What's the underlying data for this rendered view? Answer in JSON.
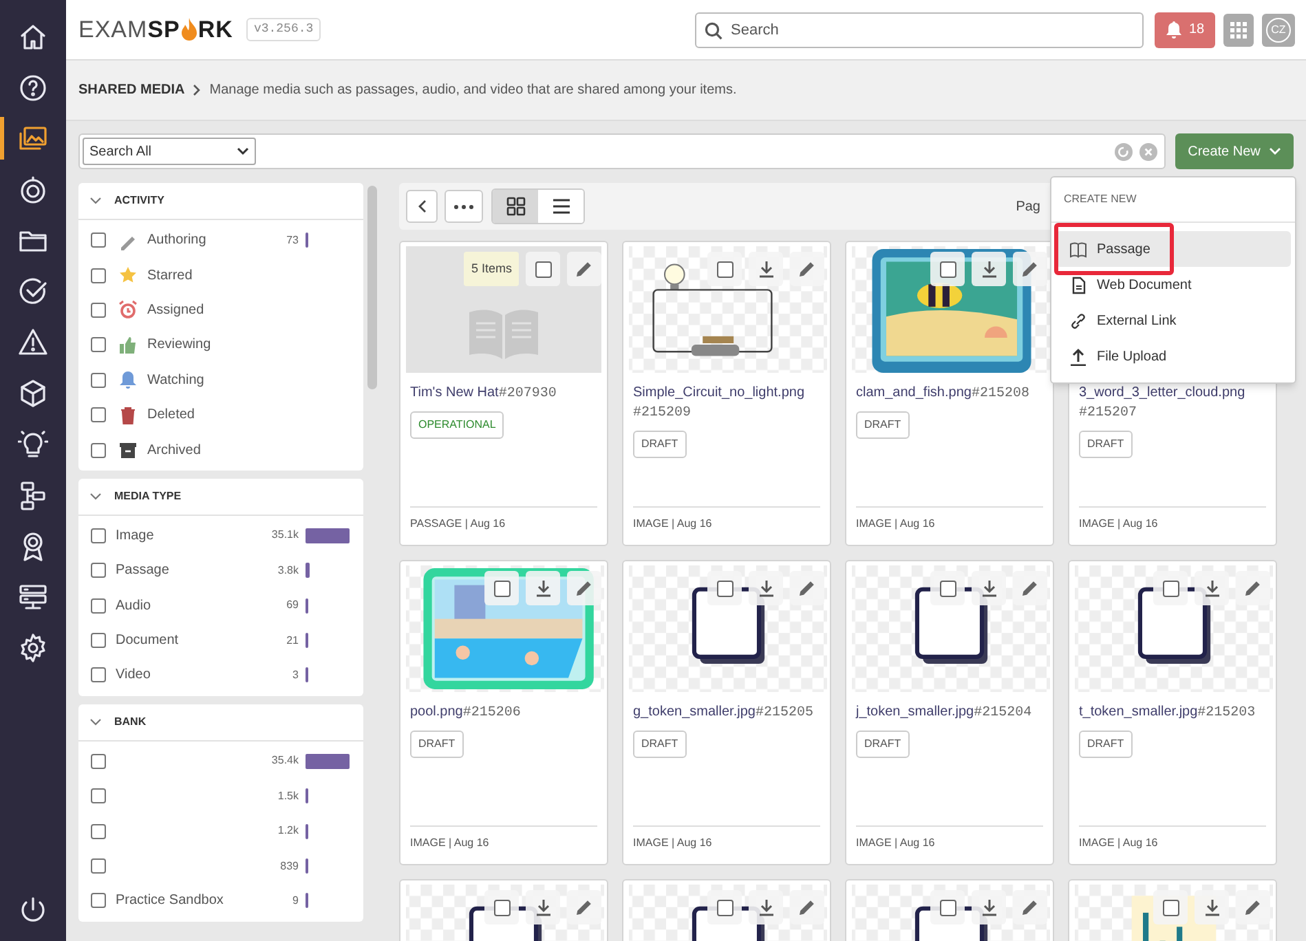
{
  "logo": {
    "part_1": "EXAM",
    "part_2": "SP",
    "part_3": "RK"
  },
  "version": "v3.256.3",
  "search": {
    "placeholder": "Search"
  },
  "notifications": {
    "count": "18"
  },
  "user": {
    "initials": "CZ"
  },
  "nav": [
    {
      "selected": false
    },
    {
      "selected": false
    },
    {
      "selected": true
    },
    {
      "selected": false
    },
    {
      "selected": false
    },
    {
      "selected": false
    },
    {
      "selected": false
    },
    {
      "selected": false
    },
    {
      "selected": false
    },
    {
      "selected": false
    },
    {
      "selected": false
    },
    {
      "selected": false
    },
    {
      "selected": false
    }
  ],
  "breadcrumb": {
    "section": "SHARED MEDIA",
    "description": "Manage media such as passages, audio, and video that are shared among your items."
  },
  "filter_bar": {
    "scope": "Search All"
  },
  "create_button": {
    "label": "Create New"
  },
  "menu": {
    "heading": "CREATE NEW",
    "items": [
      {
        "label": "Passage",
        "selected": true
      },
      {
        "label": "Web Document",
        "selected": false
      },
      {
        "label": "External Link",
        "selected": false
      },
      {
        "label": "File Upload",
        "selected": false
      }
    ]
  },
  "filters": [
    {
      "title": "ACTIVITY",
      "expanded": true,
      "options": [
        {
          "label": "Authoring",
          "count": "73",
          "checked": false
        },
        {
          "label": "Starred",
          "checked": false
        },
        {
          "label": "Assigned",
          "checked": false
        },
        {
          "label": "Reviewing",
          "checked": false
        },
        {
          "label": "Watching",
          "checked": false
        },
        {
          "label": "Deleted",
          "checked": false
        },
        {
          "label": "Archived",
          "checked": false
        }
      ]
    },
    {
      "title": "MEDIA TYPE",
      "expanded": true,
      "options": [
        {
          "label": "Image",
          "count": "35.1k",
          "checked": false
        },
        {
          "label": "Passage",
          "count": "3.8k",
          "checked": false
        },
        {
          "label": "Audio",
          "count": "69",
          "checked": false
        },
        {
          "label": "Document",
          "count": "21",
          "checked": false
        },
        {
          "label": "Video",
          "count": "3",
          "checked": false
        }
      ]
    },
    {
      "title": "BANK",
      "expanded": true,
      "options": [
        {
          "count": "35.4k",
          "checked": false
        },
        {
          "count": "1.5k",
          "checked": false
        },
        {
          "count": "1.2k",
          "checked": false
        },
        {
          "count": "839",
          "checked": false
        },
        {
          "label": "Practice Sandbox",
          "count": "9",
          "checked": false
        }
      ]
    }
  ],
  "toolbar": {
    "views": [
      {
        "selected": true
      },
      {
        "selected": false
      }
    ],
    "page_label": "Pag"
  },
  "cards": [
    {
      "kind": "passage",
      "badge": "5 Items",
      "checked": false,
      "downloadable": false,
      "title": "Tim's New Hat",
      "id": "#207930",
      "status": {
        "label": "OPERATIONAL",
        "color": "#2e8b2e"
      },
      "meta": "PASSAGE | Aug 16"
    },
    {
      "kind": "picture",
      "checked": false,
      "downloadable": true,
      "title": "Simple_Circuit_no_light.png",
      "id": "#215209",
      "status": {
        "label": "DRAFT",
        "color": "#555555"
      },
      "meta": "IMAGE | Aug 16"
    },
    {
      "kind": "picture",
      "checked": false,
      "downloadable": true,
      "title": "clam_and_fish.png",
      "id": "#215208",
      "status": {
        "label": "DRAFT",
        "color": "#555555"
      },
      "meta": "IMAGE | Aug 16"
    },
    {
      "title": "3_word_3_letter_cloud.png",
      "id": "#215207",
      "status": {
        "label": "DRAFT",
        "color": "#555555"
      },
      "meta": "IMAGE | Aug 16"
    },
    {
      "kind": "picture",
      "checked": false,
      "downloadable": true,
      "title": "pool.png",
      "id": "#215206",
      "status": {
        "label": "DRAFT",
        "color": "#555555"
      },
      "meta": "IMAGE | Aug 16"
    },
    {
      "kind": "picture",
      "checked": false,
      "downloadable": true,
      "title": "g_token_smaller.jpg",
      "id": "#215205",
      "status": {
        "label": "DRAFT",
        "color": "#555555"
      },
      "meta": "IMAGE | Aug 16"
    },
    {
      "kind": "picture",
      "checked": false,
      "downloadable": true,
      "title": "j_token_smaller.jpg",
      "id": "#215204",
      "status": {
        "label": "DRAFT",
        "color": "#555555"
      },
      "meta": "IMAGE | Aug 16"
    },
    {
      "kind": "picture",
      "checked": false,
      "downloadable": true,
      "title": "t_token_smaller.jpg",
      "id": "#215203",
      "status": {
        "label": "DRAFT",
        "color": "#555555"
      },
      "meta": "IMAGE | Aug 16"
    },
    {
      "kind": "picture",
      "checked": false,
      "downloadable": true
    },
    {
      "kind": "picture",
      "checked": false,
      "downloadable": true
    },
    {
      "kind": "picture",
      "checked": false,
      "downloadable": true
    },
    {
      "kind": "picture",
      "checked": false,
      "downloadable": true
    }
  ]
}
